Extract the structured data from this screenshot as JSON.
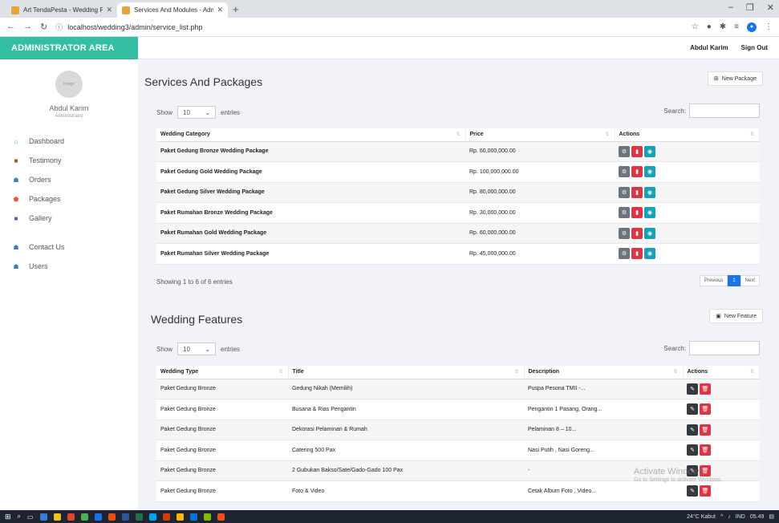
{
  "browser": {
    "tabs": [
      {
        "label": "Art TendaPesta - Wedding Planne",
        "active": false
      },
      {
        "label": "Services And Modules - Administr",
        "active": true
      }
    ],
    "url": "localhost/wedding3/admin/service_list.php"
  },
  "sidebar": {
    "brand": "ADMINISTRATOR AREA",
    "avatar_text": "Image",
    "user_name": "Abdul Karim",
    "user_role": "Administrator",
    "menu": [
      {
        "label": "Dashboard",
        "icon": "home-icon",
        "glyph": "⌂",
        "color": "#34bfa3"
      },
      {
        "label": "Testimony",
        "icon": "testimony-icon",
        "glyph": "■",
        "color": "#8b5a2b"
      },
      {
        "label": "Orders",
        "icon": "orders-icon",
        "glyph": "☗",
        "color": "#3f7fbf"
      },
      {
        "label": "Packages",
        "icon": "shield-icon",
        "glyph": "⬟",
        "color": "#e8593c"
      },
      {
        "label": "Gallery",
        "icon": "gallery-icon",
        "glyph": "■",
        "color": "#6f42c1"
      },
      {
        "label": "Contact Us",
        "icon": "contact-icon",
        "glyph": "☗",
        "color": "#3f7fbf"
      },
      {
        "label": "Users",
        "icon": "users-icon",
        "glyph": "☗",
        "color": "#3f7fbf"
      }
    ]
  },
  "topbar": {
    "user": "Abdul Karim",
    "signout": "Sign Out"
  },
  "packages": {
    "title": "Services And Packages",
    "new_button": "New Package",
    "show_label": "Show",
    "entries_value": "10",
    "entries_label": "entries",
    "search_label": "Search:",
    "columns": [
      "Wedding Category",
      "Price",
      "Actions"
    ],
    "rows": [
      {
        "category": "Paket Gedung Bronze Wedding Package",
        "price": "Rp. 60,000,000.00"
      },
      {
        "category": "Paket Gedung Gold Wedding Package",
        "price": "Rp. 100,000,000.00"
      },
      {
        "category": "Paket Gedung Silver Wedding Package",
        "price": "Rp. 80,000,000.00"
      },
      {
        "category": "Paket Rumahan Bronze Wedding Package",
        "price": "Rp. 30,000,000.00"
      },
      {
        "category": "Paket Rumahan Gold Wedding Package",
        "price": "Rp. 60,000,000.00"
      },
      {
        "category": "Paket Rumahan Silver Wedding Package",
        "price": "Rp. 45,000,000.00"
      }
    ],
    "showing": "Showing 1 to 6 of 6 entries",
    "pager": {
      "previous": "Previous",
      "current": "1",
      "next": "Next"
    }
  },
  "features": {
    "title": "Wedding Features",
    "new_button": "New Feature",
    "show_label": "Show",
    "entries_value": "10",
    "entries_label": "entries",
    "search_label": "Search:",
    "columns": [
      "Wedding Type",
      "Title",
      "Description",
      "Actions"
    ],
    "rows": [
      {
        "type": "Paket Gedung Bronze",
        "title": "Gedung Nikah (Memilih)",
        "desc": "Puspa Pesona TMII -..."
      },
      {
        "type": "Paket Gedung Bronze",
        "title": "Busana & Rias Pengantin",
        "desc": "Pengantin 1 Pasang, Orang..."
      },
      {
        "type": "Paket Gedung Bronze",
        "title": "Dekorasi Pelaminan & Rumah",
        "desc": "Pelaminan 8 – 10..."
      },
      {
        "type": "Paket Gedung Bronze",
        "title": "Catering 500 Pax",
        "desc": "Nasi Putih , Nasi Goreng..."
      },
      {
        "type": "Paket Gedung Bronze",
        "title": "2 Gubukan Bakso/Sate/Gado-Gado 100 Pax",
        "desc": "-"
      },
      {
        "type": "Paket Gedung Bronze",
        "title": "Foto & Video",
        "desc": "Cetak Album Foto , Video..."
      }
    ]
  },
  "watermark": {
    "line1": "Activate Windows",
    "line2": "Go to Settings to activate Windows."
  },
  "taskbar": {
    "weather": "24°C Kabut",
    "lang": "IND",
    "time": "05.49"
  }
}
